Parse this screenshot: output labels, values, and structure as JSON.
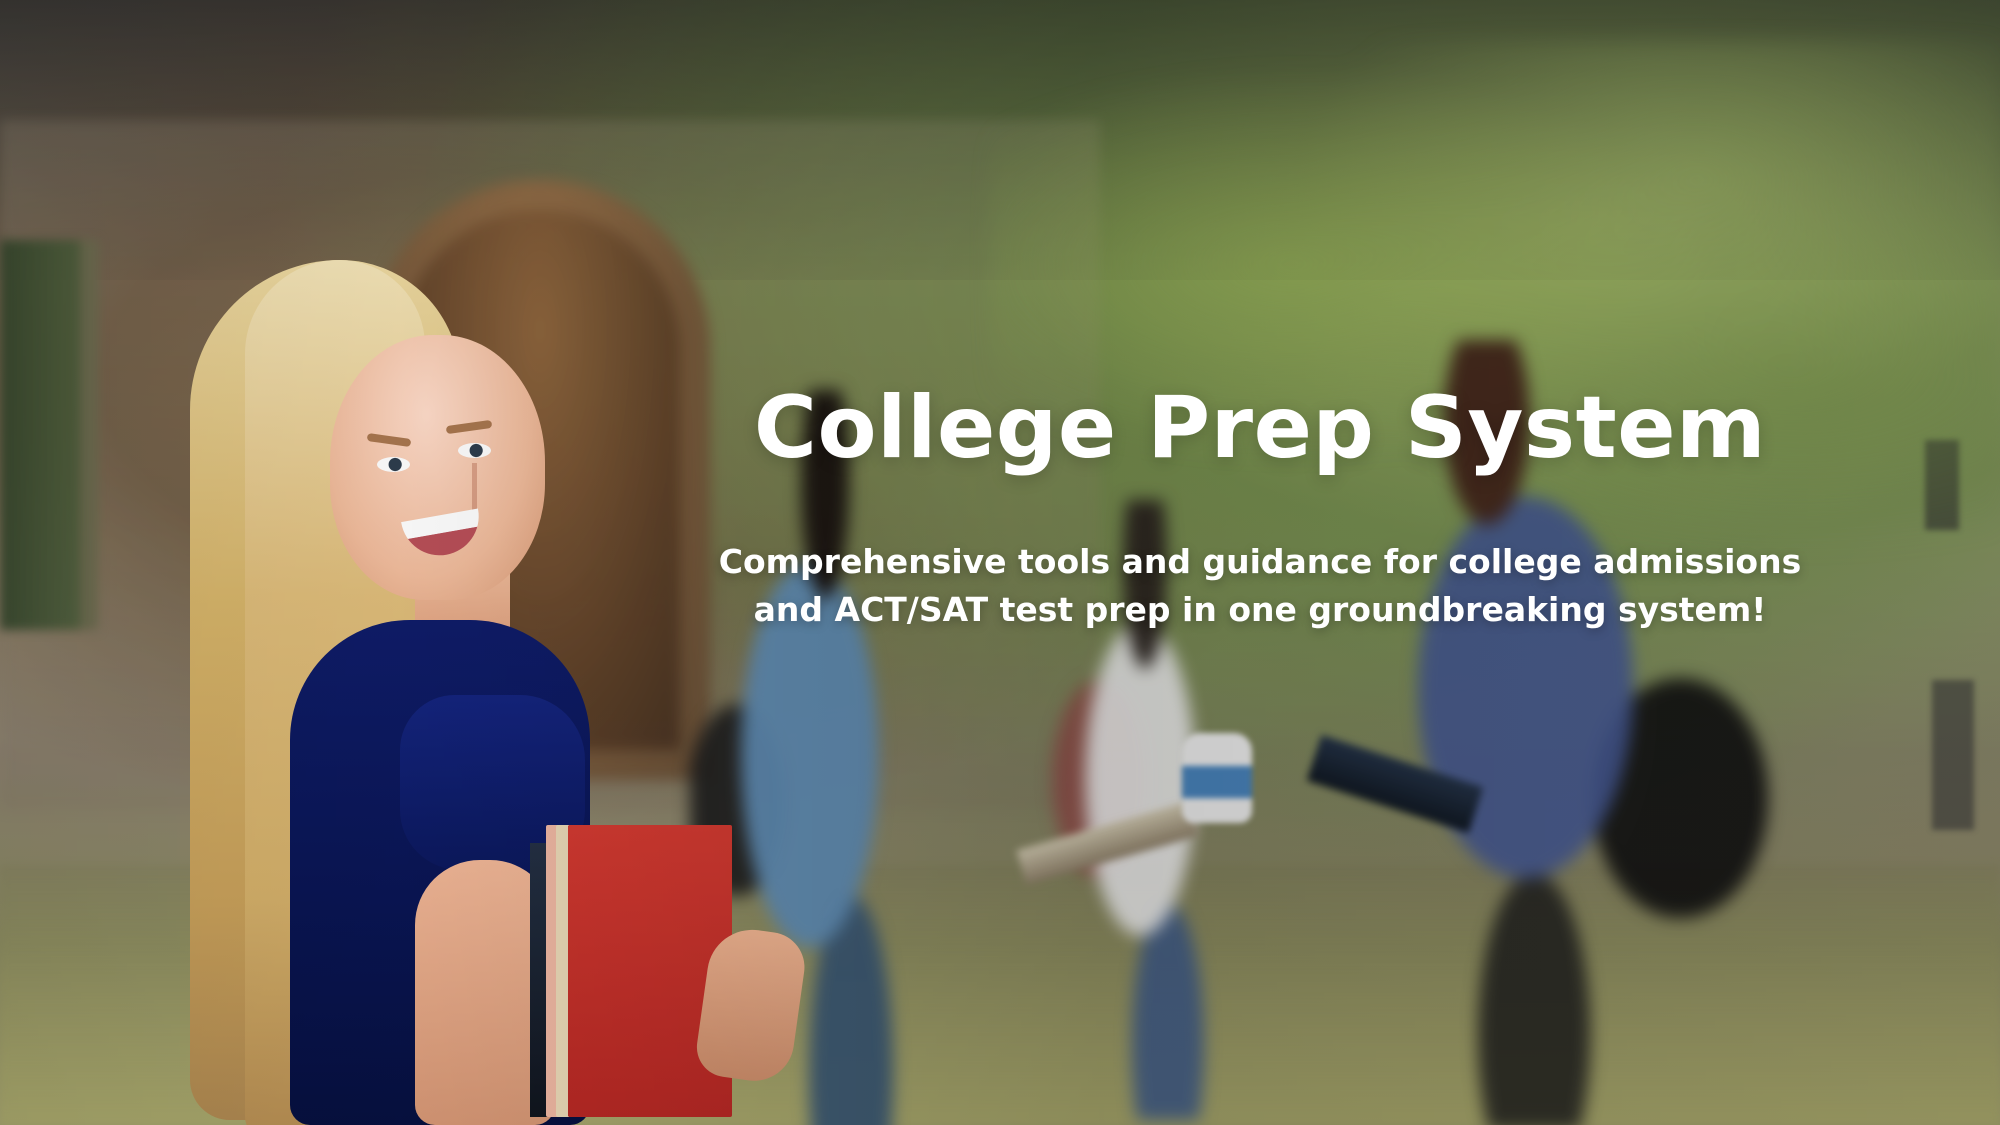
{
  "hero": {
    "title": "College Prep System",
    "subtitle": "Comprehensive tools and guidance for college admissions and ACT/SAT test prep in one groundbreaking system!"
  },
  "colors": {
    "text": "#ffffff",
    "shirt": "#0b185d",
    "book": "#c72f29"
  }
}
